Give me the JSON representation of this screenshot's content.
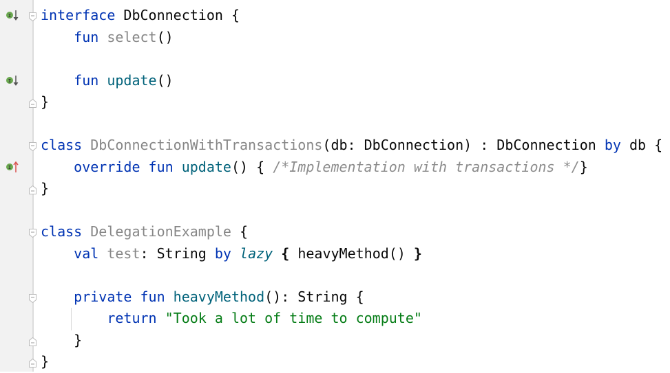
{
  "editor": {
    "lines": [
      [
        {
          "t": "interface",
          "c": "kw"
        },
        {
          "t": " DbConnection {",
          "c": "plain"
        }
      ],
      [
        {
          "t": "    ",
          "c": "plain"
        },
        {
          "t": "fun",
          "c": "kw"
        },
        {
          "t": " ",
          "c": "plain"
        },
        {
          "t": "select",
          "c": "unused"
        },
        {
          "t": "()",
          "c": "plain"
        }
      ],
      [],
      [
        {
          "t": "    ",
          "c": "plain"
        },
        {
          "t": "fun",
          "c": "kw"
        },
        {
          "t": " ",
          "c": "plain"
        },
        {
          "t": "update",
          "c": "fn"
        },
        {
          "t": "()",
          "c": "plain"
        }
      ],
      [
        {
          "t": "}",
          "c": "plain"
        }
      ],
      [],
      [
        {
          "t": "class",
          "c": "kw"
        },
        {
          "t": " ",
          "c": "plain"
        },
        {
          "t": "DbConnectionWithTransactions",
          "c": "unused"
        },
        {
          "t": "(db: DbConnection) : DbConnection ",
          "c": "plain"
        },
        {
          "t": "by",
          "c": "kw"
        },
        {
          "t": " db {",
          "c": "plain"
        }
      ],
      [
        {
          "t": "    ",
          "c": "plain"
        },
        {
          "t": "override fun",
          "c": "kw"
        },
        {
          "t": " ",
          "c": "plain"
        },
        {
          "t": "update",
          "c": "fn"
        },
        {
          "t": "() { ",
          "c": "plain"
        },
        {
          "t": "/*Implementation with transactions */",
          "c": "cmt"
        },
        {
          "t": "}",
          "c": "plain"
        }
      ],
      [
        {
          "t": "}",
          "c": "plain"
        }
      ],
      [],
      [
        {
          "t": "class",
          "c": "kw"
        },
        {
          "t": " ",
          "c": "plain"
        },
        {
          "t": "DelegationExample",
          "c": "unused"
        },
        {
          "t": " {",
          "c": "plain"
        }
      ],
      [
        {
          "t": "    ",
          "c": "plain"
        },
        {
          "t": "val",
          "c": "kw"
        },
        {
          "t": " ",
          "c": "plain"
        },
        {
          "t": "test",
          "c": "unused"
        },
        {
          "t": ": String ",
          "c": "plain"
        },
        {
          "t": "by",
          "c": "kw"
        },
        {
          "t": " ",
          "c": "plain"
        },
        {
          "t": "lazy",
          "c": "lazy"
        },
        {
          "t": " ",
          "c": "plain"
        },
        {
          "t": "{",
          "c": "bold"
        },
        {
          "t": " heavyMethod() ",
          "c": "plain"
        },
        {
          "t": "}",
          "c": "bold"
        }
      ],
      [],
      [
        {
          "t": "    ",
          "c": "plain"
        },
        {
          "t": "private fun",
          "c": "kw"
        },
        {
          "t": " ",
          "c": "plain"
        },
        {
          "t": "heavyMethod",
          "c": "fn"
        },
        {
          "t": "(): String {",
          "c": "plain"
        }
      ],
      [
        {
          "t": "        ",
          "c": "plain"
        },
        {
          "t": "return",
          "c": "kw"
        },
        {
          "t": " ",
          "c": "plain"
        },
        {
          "t": "\"Took a lot of time to compute\"",
          "c": "str"
        }
      ],
      [
        {
          "t": "    }",
          "c": "plain"
        }
      ],
      [
        {
          "t": "}",
          "c": "plain"
        }
      ]
    ]
  },
  "gutter": {
    "markers": [
      {
        "line": 1,
        "icon": "implemented-down-icon",
        "color": "#6aa84f",
        "arrow": "#555555"
      },
      {
        "line": 4,
        "icon": "implemented-down-icon",
        "color": "#6aa84f",
        "arrow": "#555555"
      },
      {
        "line": 8,
        "icon": "implements-up-icon",
        "color": "#6aa84f",
        "arrow": "#d9534f"
      }
    ],
    "folds": [
      {
        "line": 1,
        "type": "start"
      },
      {
        "line": 5,
        "type": "end"
      },
      {
        "line": 7,
        "type": "start"
      },
      {
        "line": 9,
        "type": "end"
      },
      {
        "line": 11,
        "type": "start"
      },
      {
        "line": 14,
        "type": "start"
      },
      {
        "line": 16,
        "type": "end"
      },
      {
        "line": 17,
        "type": "end"
      }
    ]
  }
}
